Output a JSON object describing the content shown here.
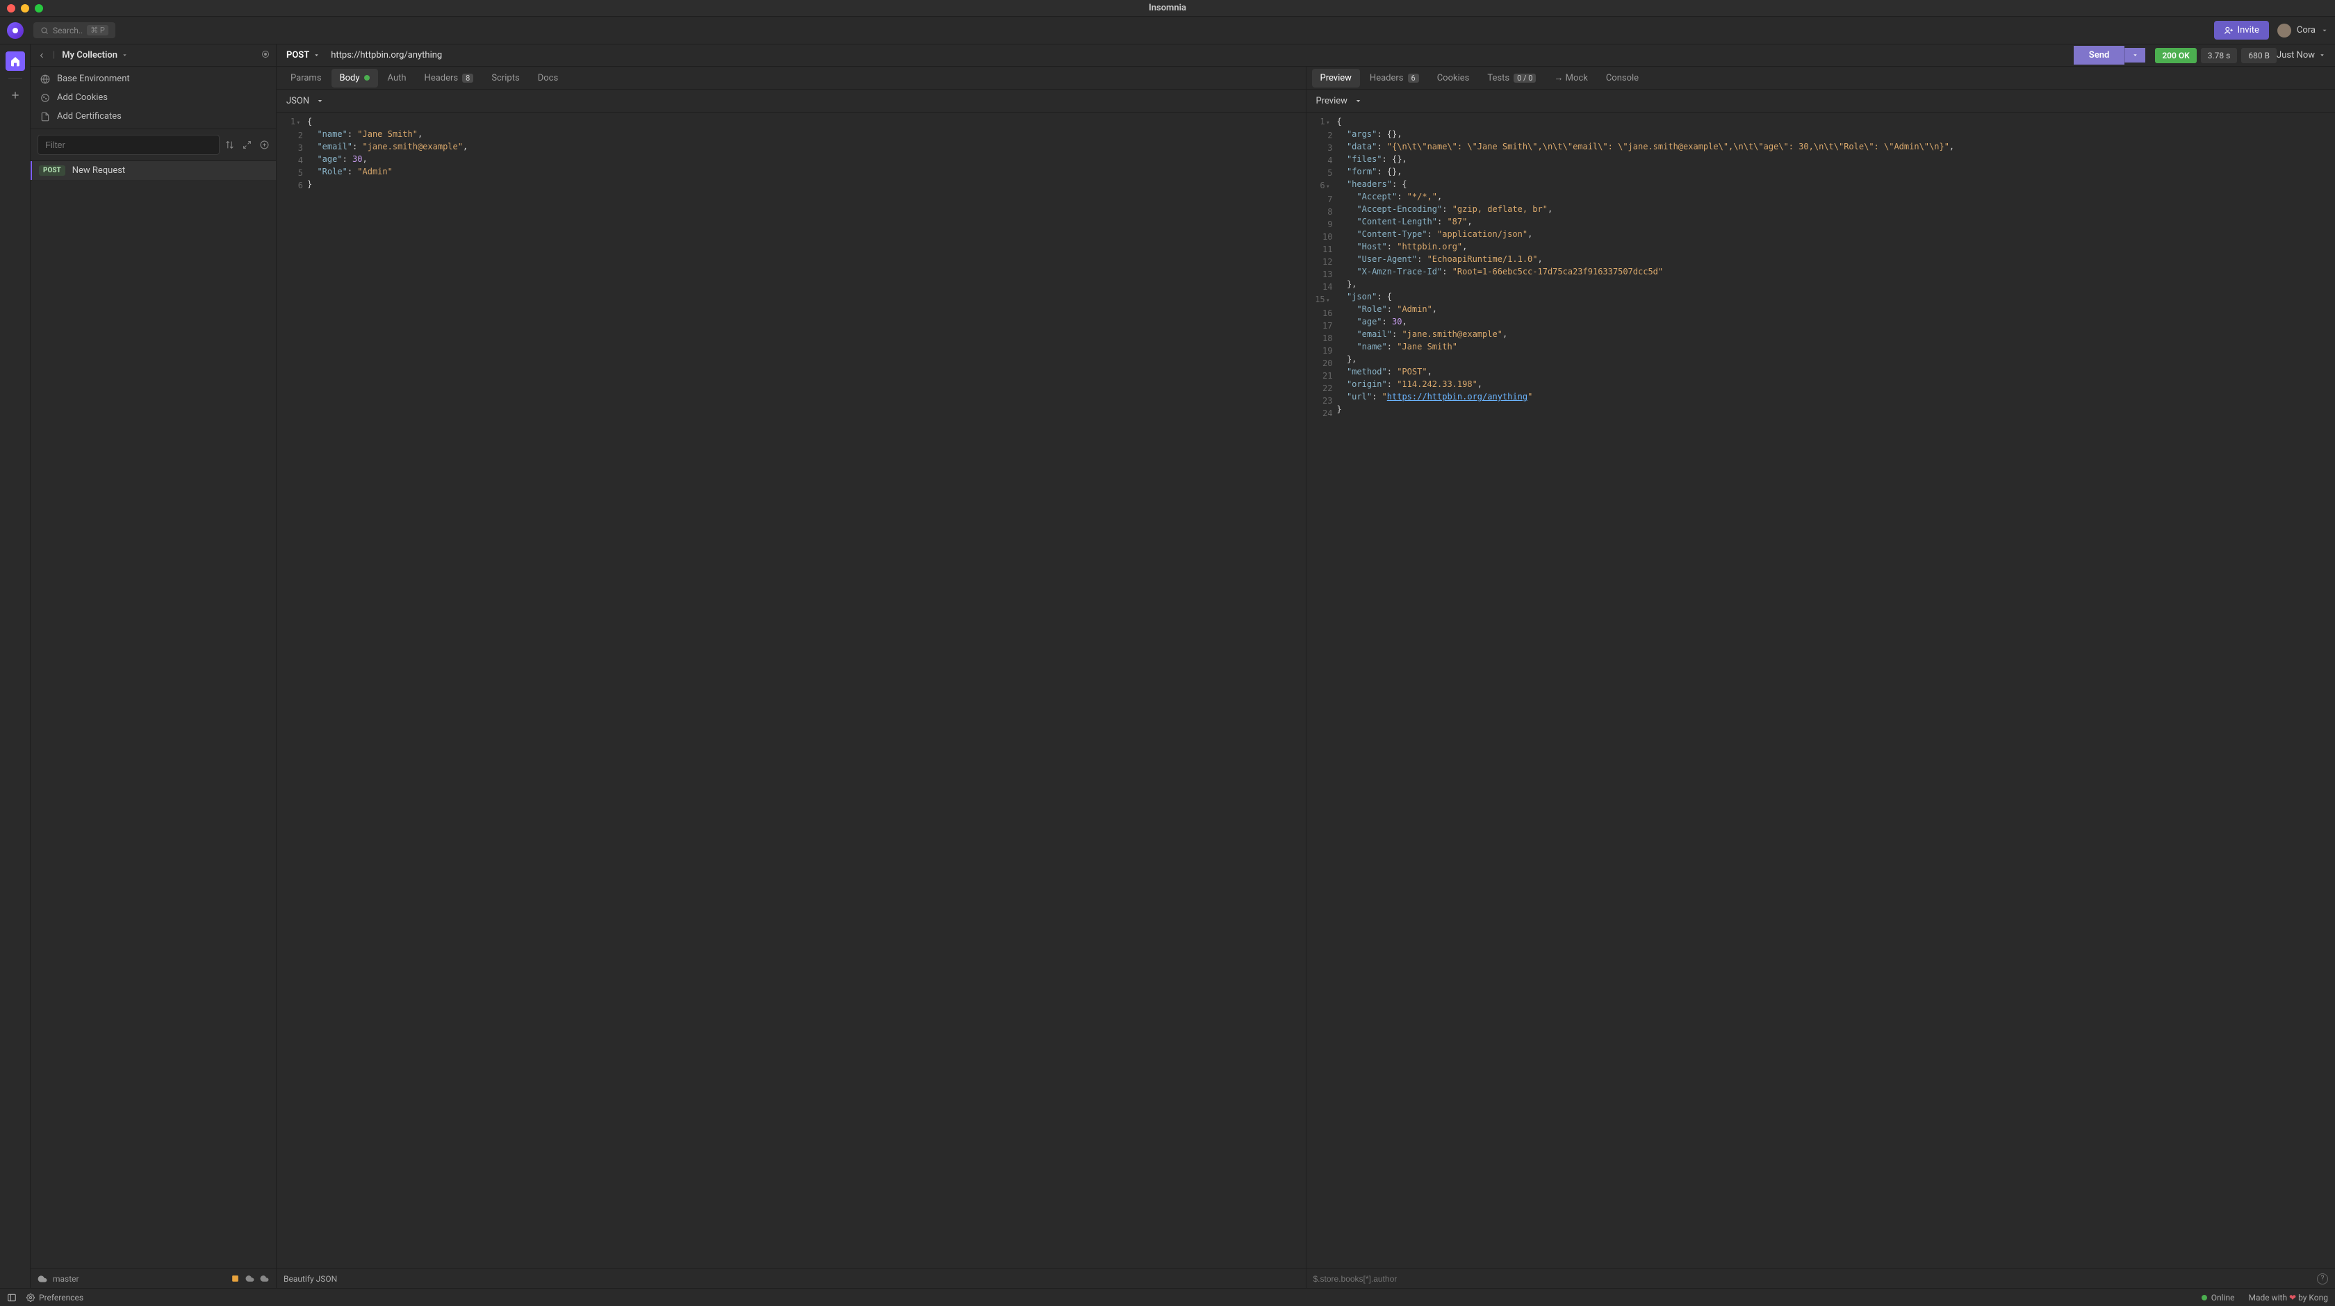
{
  "window": {
    "title": "Insomnia"
  },
  "toolbar": {
    "search_placeholder": "Search..",
    "search_shortcut": "⌘ P",
    "invite_label": "Invite",
    "user_name": "Cora"
  },
  "sidebar": {
    "collection_name": "My Collection",
    "links": {
      "base_env": "Base Environment",
      "add_cookies": "Add Cookies",
      "add_certs": "Add Certificates"
    },
    "filter_placeholder": "Filter",
    "request": {
      "method": "POST",
      "name": "New Request"
    },
    "branch": "master"
  },
  "request": {
    "method": "POST",
    "url": "https://httpbin.org/anything",
    "send": "Send",
    "body_type_label": "JSON",
    "tabs": {
      "params": "Params",
      "body": "Body",
      "auth": "Auth",
      "headers": "Headers",
      "headers_count": "8",
      "scripts": "Scripts",
      "docs": "Docs"
    },
    "body_lines": [
      {
        "n": "1",
        "t": [
          [
            "{",
            "punct"
          ]
        ],
        "fold": true
      },
      {
        "n": "2",
        "t": [
          [
            "  ",
            "plain"
          ],
          [
            "\"name\"",
            "key"
          ],
          [
            ": ",
            "punct"
          ],
          [
            "\"Jane Smith\"",
            "str"
          ],
          [
            ",",
            "punct"
          ]
        ]
      },
      {
        "n": "3",
        "t": [
          [
            "  ",
            "plain"
          ],
          [
            "\"email\"",
            "key"
          ],
          [
            ": ",
            "punct"
          ],
          [
            "\"jane.smith@example\"",
            "str"
          ],
          [
            ",",
            "punct"
          ]
        ]
      },
      {
        "n": "4",
        "t": [
          [
            "  ",
            "plain"
          ],
          [
            "\"age\"",
            "key"
          ],
          [
            ": ",
            "punct"
          ],
          [
            "30",
            "num"
          ],
          [
            ",",
            "punct"
          ]
        ]
      },
      {
        "n": "5",
        "t": [
          [
            "  ",
            "plain"
          ],
          [
            "\"Role\"",
            "key"
          ],
          [
            ": ",
            "punct"
          ],
          [
            "\"Admin\"",
            "str"
          ]
        ]
      },
      {
        "n": "6",
        "t": [
          [
            "}",
            "punct"
          ]
        ]
      }
    ],
    "footer": {
      "beautify": "Beautify JSON"
    }
  },
  "response": {
    "status": "200 OK",
    "time": "3.78 s",
    "size": "680 B",
    "timestamp": "Just Now",
    "preview_label": "Preview",
    "tabs": {
      "preview": "Preview",
      "headers": "Headers",
      "headers_count": "6",
      "cookies": "Cookies",
      "tests": "Tests",
      "tests_count": "0 / 0",
      "mock": "→ Mock",
      "console": "Console"
    },
    "jsonpath_placeholder": "$.store.books[*].author",
    "body_lines": [
      {
        "n": "1",
        "t": [
          [
            "{",
            "punct"
          ]
        ],
        "fold": true
      },
      {
        "n": "2",
        "t": [
          [
            "  ",
            "plain"
          ],
          [
            "\"args\"",
            "key"
          ],
          [
            ": {},",
            "punct"
          ]
        ]
      },
      {
        "n": "3",
        "t": [
          [
            "  ",
            "plain"
          ],
          [
            "\"data\"",
            "key"
          ],
          [
            ": ",
            "punct"
          ],
          [
            "\"{\\n\\t\\\"name\\\": \\\"Jane Smith\\\",\\n\\t\\\"email\\\": \\\"jane.smith@example\\\",\\n\\t\\\"age\\\": 30,\\n\\t\\\"Role\\\": \\\"Admin\\\"\\n}\"",
            "str"
          ],
          [
            ",",
            "punct"
          ]
        ],
        "wrap": true
      },
      {
        "n": "4",
        "t": [
          [
            "  ",
            "plain"
          ],
          [
            "\"files\"",
            "key"
          ],
          [
            ": {},",
            "punct"
          ]
        ]
      },
      {
        "n": "5",
        "t": [
          [
            "  ",
            "plain"
          ],
          [
            "\"form\"",
            "key"
          ],
          [
            ": {},",
            "punct"
          ]
        ]
      },
      {
        "n": "6",
        "t": [
          [
            "  ",
            "plain"
          ],
          [
            "\"headers\"",
            "key"
          ],
          [
            ": {",
            "punct"
          ]
        ],
        "fold": true
      },
      {
        "n": "7",
        "t": [
          [
            "    ",
            "plain"
          ],
          [
            "\"Accept\"",
            "key"
          ],
          [
            ": ",
            "punct"
          ],
          [
            "\"*/*,\"",
            "str"
          ],
          [
            ",",
            "punct"
          ]
        ]
      },
      {
        "n": "8",
        "t": [
          [
            "    ",
            "plain"
          ],
          [
            "\"Accept-Encoding\"",
            "key"
          ],
          [
            ": ",
            "punct"
          ],
          [
            "\"gzip, deflate, br\"",
            "str"
          ],
          [
            ",",
            "punct"
          ]
        ]
      },
      {
        "n": "9",
        "t": [
          [
            "    ",
            "plain"
          ],
          [
            "\"Content-Length\"",
            "key"
          ],
          [
            ": ",
            "punct"
          ],
          [
            "\"87\"",
            "str"
          ],
          [
            ",",
            "punct"
          ]
        ]
      },
      {
        "n": "10",
        "t": [
          [
            "    ",
            "plain"
          ],
          [
            "\"Content-Type\"",
            "key"
          ],
          [
            ": ",
            "punct"
          ],
          [
            "\"application/json\"",
            "str"
          ],
          [
            ",",
            "punct"
          ]
        ]
      },
      {
        "n": "11",
        "t": [
          [
            "    ",
            "plain"
          ],
          [
            "\"Host\"",
            "key"
          ],
          [
            ": ",
            "punct"
          ],
          [
            "\"httpbin.org\"",
            "str"
          ],
          [
            ",",
            "punct"
          ]
        ]
      },
      {
        "n": "12",
        "t": [
          [
            "    ",
            "plain"
          ],
          [
            "\"User-Agent\"",
            "key"
          ],
          [
            ": ",
            "punct"
          ],
          [
            "\"EchoapiRuntime/1.1.0\"",
            "str"
          ],
          [
            ",",
            "punct"
          ]
        ]
      },
      {
        "n": "13",
        "t": [
          [
            "    ",
            "plain"
          ],
          [
            "\"X-Amzn-Trace-Id\"",
            "key"
          ],
          [
            ": ",
            "punct"
          ],
          [
            "\"Root=1-66ebc5cc-17d75ca23f916337507dcc5d\"",
            "str"
          ]
        ]
      },
      {
        "n": "14",
        "t": [
          [
            "  },",
            "punct"
          ]
        ]
      },
      {
        "n": "15",
        "t": [
          [
            "  ",
            "plain"
          ],
          [
            "\"json\"",
            "key"
          ],
          [
            ": {",
            "punct"
          ]
        ],
        "fold": true
      },
      {
        "n": "16",
        "t": [
          [
            "    ",
            "plain"
          ],
          [
            "\"Role\"",
            "key"
          ],
          [
            ": ",
            "punct"
          ],
          [
            "\"Admin\"",
            "str"
          ],
          [
            ",",
            "punct"
          ]
        ]
      },
      {
        "n": "17",
        "t": [
          [
            "    ",
            "plain"
          ],
          [
            "\"age\"",
            "key"
          ],
          [
            ": ",
            "punct"
          ],
          [
            "30",
            "num"
          ],
          [
            ",",
            "punct"
          ]
        ]
      },
      {
        "n": "18",
        "t": [
          [
            "    ",
            "plain"
          ],
          [
            "\"email\"",
            "key"
          ],
          [
            ": ",
            "punct"
          ],
          [
            "\"jane.smith@example\"",
            "str"
          ],
          [
            ",",
            "punct"
          ]
        ]
      },
      {
        "n": "19",
        "t": [
          [
            "    ",
            "plain"
          ],
          [
            "\"name\"",
            "key"
          ],
          [
            ": ",
            "punct"
          ],
          [
            "\"Jane Smith\"",
            "str"
          ]
        ]
      },
      {
        "n": "20",
        "t": [
          [
            "  },",
            "punct"
          ]
        ]
      },
      {
        "n": "21",
        "t": [
          [
            "  ",
            "plain"
          ],
          [
            "\"method\"",
            "key"
          ],
          [
            ": ",
            "punct"
          ],
          [
            "\"POST\"",
            "str"
          ],
          [
            ",",
            "punct"
          ]
        ]
      },
      {
        "n": "22",
        "t": [
          [
            "  ",
            "plain"
          ],
          [
            "\"origin\"",
            "key"
          ],
          [
            ": ",
            "punct"
          ],
          [
            "\"114.242.33.198\"",
            "str"
          ],
          [
            ",",
            "punct"
          ]
        ]
      },
      {
        "n": "23",
        "t": [
          [
            "  ",
            "plain"
          ],
          [
            "\"url\"",
            "key"
          ],
          [
            ": ",
            "punct"
          ],
          [
            "\"",
            "str"
          ],
          [
            "https://httpbin.org/anything",
            "link"
          ],
          [
            "\"",
            "str"
          ]
        ]
      },
      {
        "n": "24",
        "t": [
          [
            "}",
            "punct"
          ]
        ]
      }
    ]
  },
  "statusbar": {
    "preferences": "Preferences",
    "online": "Online",
    "made_with_pre": "Made with ",
    "made_with_post": " by Kong"
  }
}
